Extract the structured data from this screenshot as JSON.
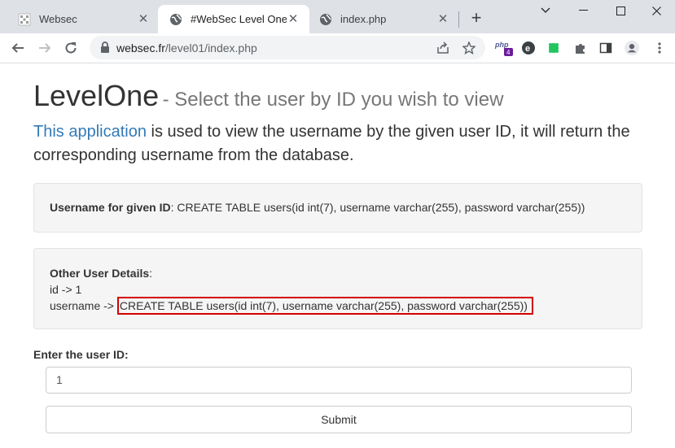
{
  "tabs": [
    {
      "title": "Websec",
      "favicon": "websec-grid-icon",
      "active": false
    },
    {
      "title": "#WebSec Level One",
      "favicon": "globe-icon",
      "active": true
    },
    {
      "title": "index.php",
      "favicon": "globe-icon",
      "active": false
    }
  ],
  "window_controls": [
    "chevron-down-icon",
    "minimize-icon",
    "maximize-icon",
    "close-icon"
  ],
  "toolbar": {
    "url_host": "websec.fr",
    "url_path": "/level01/index.php",
    "extensions": [
      {
        "name": "php-extension-icon",
        "badge": "4"
      },
      {
        "name": "e-extension-icon"
      },
      {
        "name": "green-extension-icon"
      },
      {
        "name": "puzzle-icon"
      },
      {
        "name": "side-panel-icon"
      },
      {
        "name": "profile-icon"
      },
      {
        "name": "menu-icon"
      }
    ]
  },
  "page": {
    "heading": "LevelOne",
    "subheading": "- Select the user by ID you wish to view",
    "intro_link": "This application",
    "intro_text": " is used to view the username by the given user ID, it will return the corresponding username from the database.",
    "result_label": "Username for given ID",
    "result_value": ": CREATE TABLE users(id int(7), username varchar(255), password varchar(255))",
    "details_label": "Other User Details",
    "details_colon": ":",
    "id_line": "id -> 1",
    "username_prefix": "username -> ",
    "username_value": "CREATE TABLE users(id int(7), username varchar(255), password varchar(255))",
    "input_label": "Enter the user ID:",
    "input_value": "1",
    "submit_label": "Submit"
  },
  "colors": {
    "link": "#337ab7",
    "highlight_border": "#d40000",
    "tabstrip": "#dee1e6"
  }
}
